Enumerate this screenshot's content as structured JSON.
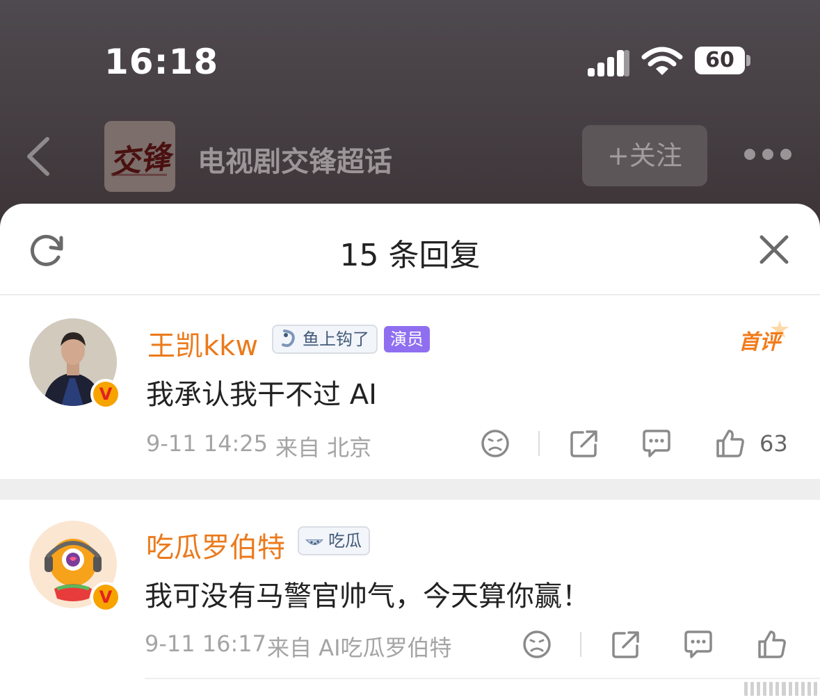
{
  "status_bar": {
    "time": "16:18",
    "battery": "60"
  },
  "header": {
    "title": "电视剧交锋超话",
    "follow_label": "+关注",
    "logo_text": "交锋"
  },
  "sheet": {
    "title": "15 条回复"
  },
  "comments": [
    {
      "username": "王凯kkw",
      "tag": "鱼上钩了",
      "role": "演员",
      "first_badge": "首评",
      "content": "我承认我干不过 AI",
      "time": "9-11 14:25",
      "source": "来自 北京",
      "likes": "63"
    },
    {
      "username": "吃瓜罗伯特",
      "tag": "吃瓜",
      "content": "我可没有马警官帅气，今天算你赢！",
      "time": "9-11 16:17",
      "source": "来自 AI吃瓜罗伯特"
    }
  ],
  "icons": {
    "back": "back-arrow-icon",
    "more": "more-icon",
    "refresh": "refresh-icon",
    "close": "close-icon",
    "dislike": "sad-face-icon",
    "share": "share-icon",
    "reply": "comment-icon",
    "like": "thumbs-up-icon"
  },
  "colors": {
    "username": "#eb7a1b",
    "role_badge": "#8f6ff0",
    "verify_badge": "#f7a300",
    "first_badge": "#f27b1b"
  }
}
